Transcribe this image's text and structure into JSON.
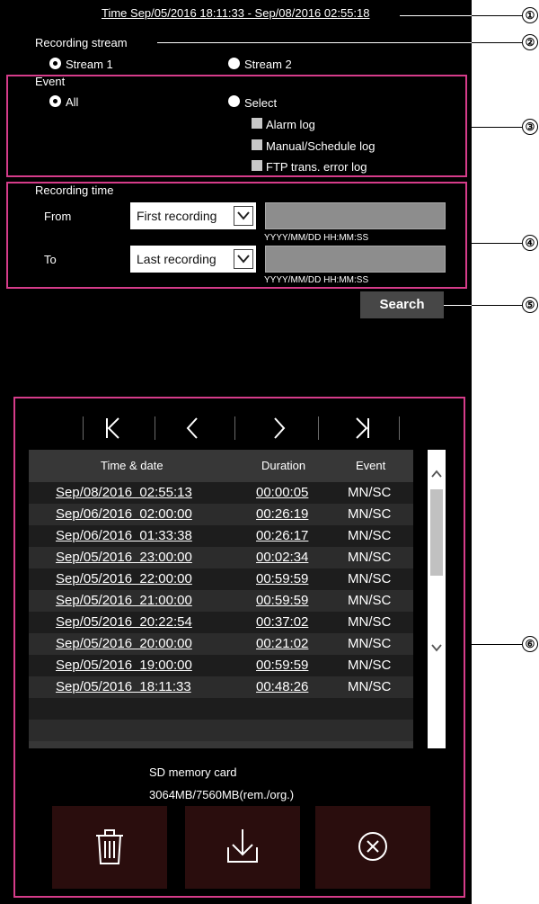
{
  "header": {
    "time_range": "Time Sep/05/2016 18:11:33 - Sep/08/2016 02:55:18"
  },
  "recording_stream": {
    "label": "Recording stream",
    "options": [
      "Stream 1",
      "Stream 2"
    ],
    "selected": "Stream 1"
  },
  "event": {
    "label": "Event",
    "all_label": "All",
    "select_label": "Select",
    "selected": "All",
    "checkboxes": [
      "Alarm log",
      "Manual/Schedule log",
      "FTP trans. error log"
    ]
  },
  "recording_time": {
    "label": "Recording time",
    "from_label": "From",
    "to_label": "To",
    "from_value": "First recording",
    "to_value": "Last recording",
    "format_hint": "YYYY/MM/DD HH:MM:SS"
  },
  "search": {
    "label": "Search"
  },
  "nav": {
    "icons": [
      "first-page-icon",
      "previous-page-icon",
      "next-page-icon",
      "last-page-icon"
    ]
  },
  "table": {
    "headers": [
      "Time & date",
      "Duration",
      "Event"
    ],
    "rows": [
      [
        "Sep/08/2016  02:55:13",
        "00:00:05",
        "MN/SC"
      ],
      [
        "Sep/06/2016  02:00:00",
        "00:26:19",
        "MN/SC"
      ],
      [
        "Sep/06/2016  01:33:38",
        "00:26:17",
        "MN/SC"
      ],
      [
        "Sep/05/2016  23:00:00",
        "00:02:34",
        "MN/SC"
      ],
      [
        "Sep/05/2016  22:00:00",
        "00:59:59",
        "MN/SC"
      ],
      [
        "Sep/05/2016  21:00:00",
        "00:59:59",
        "MN/SC"
      ],
      [
        "Sep/05/2016  20:22:54",
        "00:37:02",
        "MN/SC"
      ],
      [
        "Sep/05/2016  20:00:00",
        "00:21:02",
        "MN/SC"
      ],
      [
        "Sep/05/2016  19:00:00",
        "00:59:59",
        "MN/SC"
      ],
      [
        "Sep/05/2016  18:11:33",
        "00:48:26",
        "MN/SC"
      ]
    ]
  },
  "sd_card": {
    "label": "SD memory card",
    "capacity": "3064MB/7560MB(rem./org.)"
  },
  "actions": [
    "delete-icon",
    "download-icon",
    "close-icon"
  ],
  "callouts": [
    "①",
    "②",
    "③",
    "④",
    "⑤",
    "⑥"
  ],
  "colors": {
    "accent": "#d63c8a",
    "background": "#000000"
  }
}
